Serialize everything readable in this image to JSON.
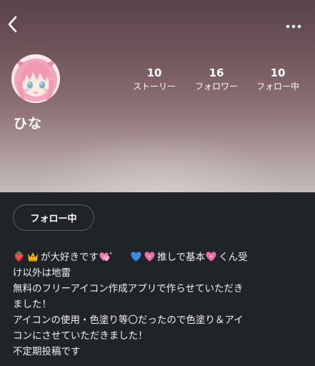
{
  "header": {
    "back_icon": "chevron-left-icon",
    "more_icon": "more-dots-icon"
  },
  "profile": {
    "username": "ひな",
    "avatar_icon": "anime-avatar"
  },
  "stats": [
    {
      "count": "10",
      "label": "ストーリー"
    },
    {
      "count": "16",
      "label": "フォロワー"
    },
    {
      "count": "10",
      "label": "フォロー中"
    }
  ],
  "follow_button": {
    "label": "フォロー中"
  },
  "bio": {
    "line1_a": "が大好きです",
    "line1_b": "推しで基本",
    "line1_c": "くん受",
    "line2": "け以外は地雷",
    "line3": "無料のフリーアイコン作成アプリで作らせていただき",
    "line4": "ました！",
    "line5": "アイコンの使用・色塗り等〇だったので色塗り＆アイ",
    "line6": "コンにさせていただきました！",
    "line7": "不定期投稿です"
  },
  "colors": {
    "background": "#202327",
    "header_top": "#584449",
    "header_bottom": "#c4bcbc",
    "button_border": "#5b5f66"
  }
}
